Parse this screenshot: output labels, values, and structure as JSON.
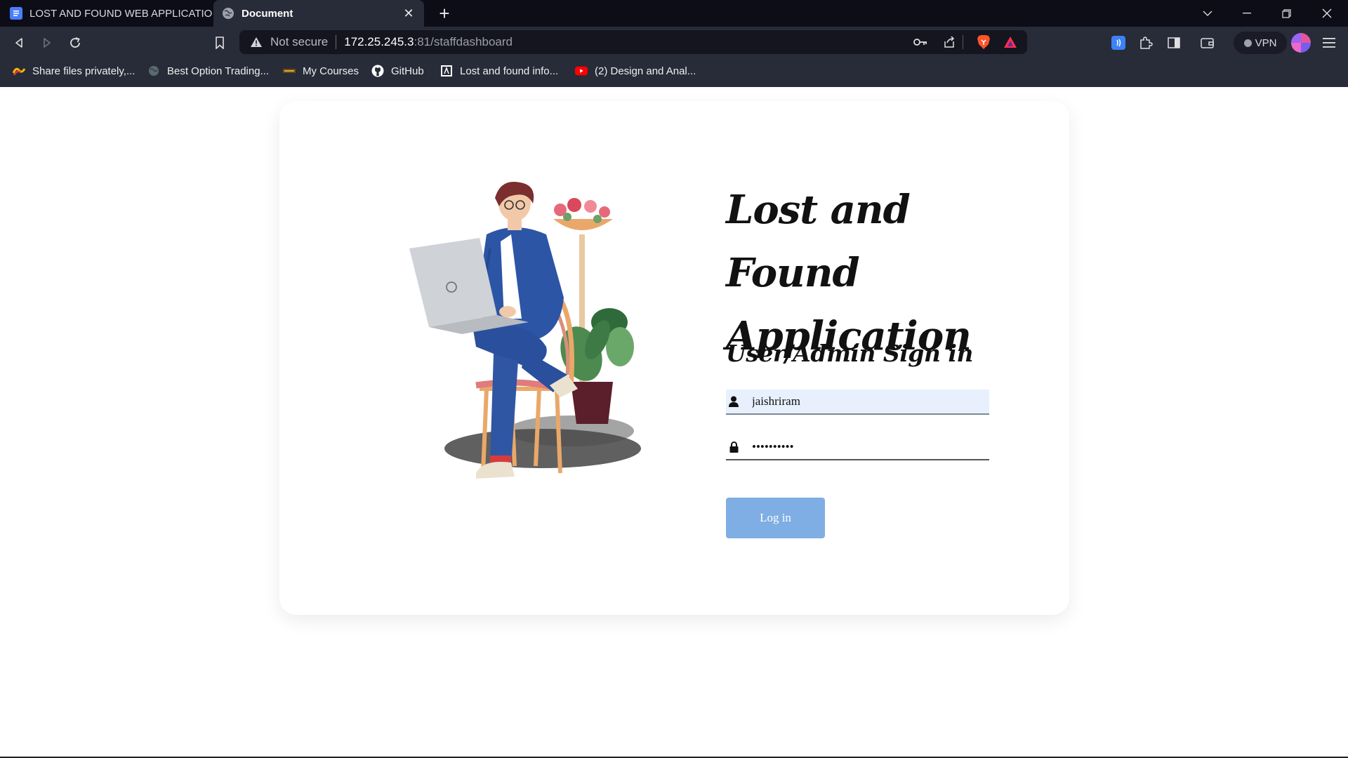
{
  "browser": {
    "tabs": [
      {
        "title": "LOST AND FOUND WEB APPLICATION",
        "active": false,
        "icon": "docs-icon"
      },
      {
        "title": "Document",
        "active": true,
        "icon": "globe-icon"
      }
    ],
    "new_tab_label": "+",
    "address": {
      "security_label": "Not secure",
      "host": "172.25.245.3",
      "path": ":81/staffdashboard"
    },
    "vpn_label": "VPN",
    "bookmarks": [
      {
        "label": "Share files privately,...",
        "icon": "share-files-icon"
      },
      {
        "label": "Best Option Trading...",
        "icon": "globe-icon"
      },
      {
        "label": "My Courses",
        "icon": "courses-icon"
      },
      {
        "label": "GitHub",
        "icon": "github-icon"
      },
      {
        "label": "Lost and found info...",
        "icon": "lost-found-icon"
      },
      {
        "label": "(2) Design and Anal...",
        "icon": "youtube-icon"
      }
    ]
  },
  "page": {
    "app_title": "Lost and Found Application",
    "signin_title": "User/Admin Sign in",
    "username_value": "jaishriram",
    "password_value": "••••••••••",
    "login_label": "Log in"
  },
  "colors": {
    "chrome_dark": "#0c0d17",
    "toolbar": "#282b38",
    "login_button": "#7eaee3",
    "autofill_bg": "#e8f0fe"
  }
}
